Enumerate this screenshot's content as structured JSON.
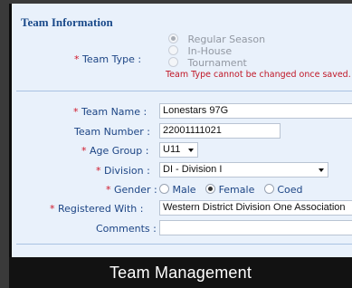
{
  "section_title": "Team Information",
  "required_mark": "*",
  "colon": ":",
  "team_type": {
    "label": "Team Type",
    "options": [
      "Regular Season",
      "In-House",
      "Tournament"
    ],
    "selected": "Regular Season",
    "note": "Team Type cannot be changed once saved."
  },
  "team_name": {
    "label": "Team Name",
    "value": "Lonestars 97G"
  },
  "team_number": {
    "label": "Team Number",
    "value": "22001111021"
  },
  "age_group": {
    "label": "Age Group",
    "value": "U11"
  },
  "division": {
    "label": "Division",
    "value": "DI - Division I"
  },
  "gender": {
    "label": "Gender",
    "options": [
      "Male",
      "Female",
      "Coed"
    ],
    "selected": "Female"
  },
  "registered_with": {
    "label": "Registered With",
    "value": "Western District Division One Association"
  },
  "comments": {
    "label": "Comments",
    "value": ""
  },
  "caption": "Team Management",
  "colors": {
    "label_blue": "#1d4585",
    "required_red": "#d0182a",
    "panel_bg": "#e9f1fb",
    "caption_bg": "#121212"
  }
}
